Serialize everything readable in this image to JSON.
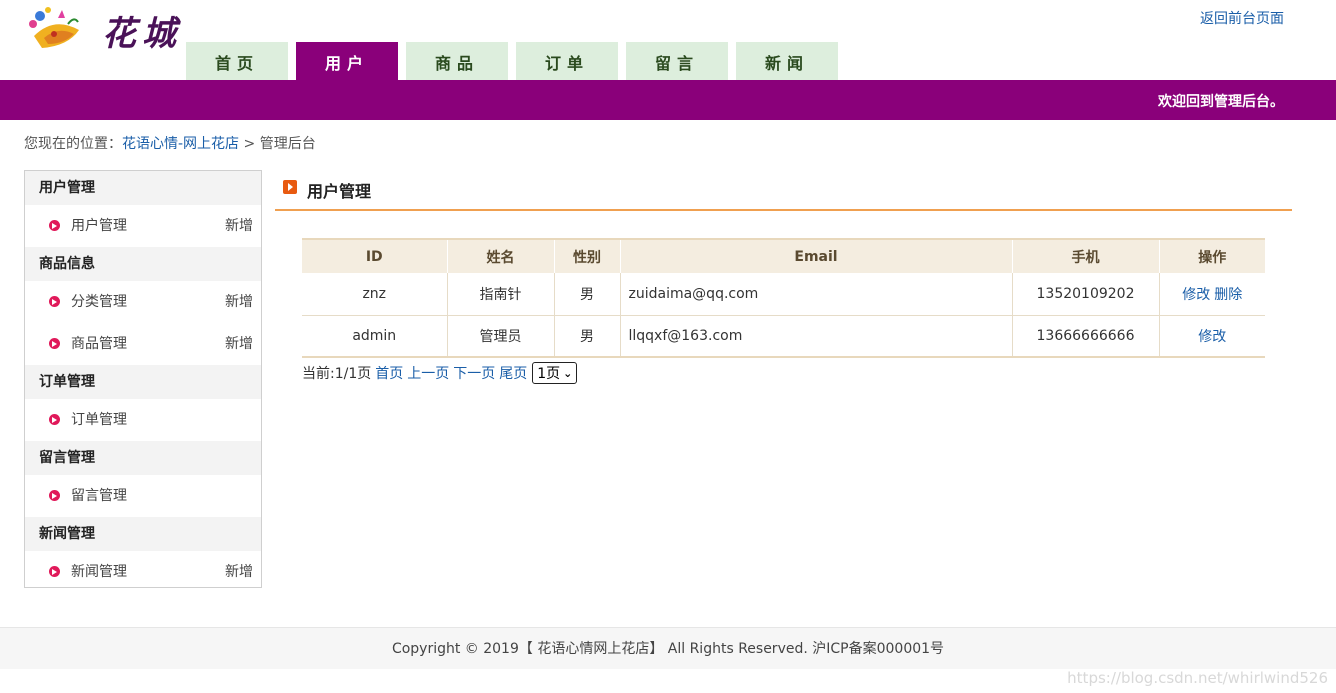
{
  "header": {
    "logo_text": "花城",
    "back_link": "返回前台页面",
    "welcome": "欢迎回到管理后台。"
  },
  "nav": {
    "items": [
      {
        "label": "首页",
        "active": false
      },
      {
        "label": "用户",
        "active": true
      },
      {
        "label": "商品",
        "active": false
      },
      {
        "label": "订单",
        "active": false
      },
      {
        "label": "留言",
        "active": false
      },
      {
        "label": "新闻",
        "active": false
      }
    ]
  },
  "breadcrumb": {
    "prefix": "您现在的位置：",
    "home": "花语心情-网上花店",
    "separator": " > ",
    "current": "管理后台"
  },
  "sidebar": {
    "groups": [
      {
        "title": "用户管理",
        "items": [
          {
            "label": "用户管理",
            "action": "新增"
          }
        ]
      },
      {
        "title": "商品信息",
        "items": [
          {
            "label": "分类管理",
            "action": "新增"
          },
          {
            "label": "商品管理",
            "action": "新增"
          }
        ]
      },
      {
        "title": "订单管理",
        "items": [
          {
            "label": "订单管理",
            "action": ""
          }
        ]
      },
      {
        "title": "留言管理",
        "items": [
          {
            "label": "留言管理",
            "action": ""
          }
        ]
      },
      {
        "title": "新闻管理",
        "items": [
          {
            "label": "新闻管理",
            "action": "新增"
          }
        ]
      }
    ]
  },
  "main": {
    "title": "用户管理",
    "table": {
      "headers": [
        "ID",
        "姓名",
        "性别",
        "Email",
        "手机",
        "操作"
      ],
      "rows": [
        {
          "id": "znz",
          "name": "指南针",
          "sex": "男",
          "email": "zuidaima@qq.com",
          "phone": "13520109202",
          "edit": "修改",
          "delete": "删除"
        },
        {
          "id": "admin",
          "name": "管理员",
          "sex": "男",
          "email": "llqqxf@163.com",
          "phone": "13666666666",
          "edit": "修改",
          "delete": ""
        }
      ]
    },
    "pager": {
      "current": "当前:1/1页",
      "first": "首页",
      "prev": "上一页",
      "next": "下一页",
      "last": "尾页",
      "select_value": "1页"
    }
  },
  "footer": {
    "text": "Copyright © 2019【 花语心情网上花店】 All Rights Reserved. 沪ICP备案000001号"
  },
  "watermark": "https://blog.csdn.net/whirlwind526",
  "colors": {
    "accent_purple": "#8a007a",
    "nav_inactive": "#ddeedd",
    "link_blue": "#1a5ea8",
    "title_underline": "#f0a050",
    "bullet_pink": "#e0195a"
  },
  "icons": {
    "logo": "flower-bouquet-logo",
    "title": "orange-arrow-square-icon",
    "sidebar_bullet": "pink-arrow-circle-icon",
    "select": "chevron-down-icon"
  }
}
